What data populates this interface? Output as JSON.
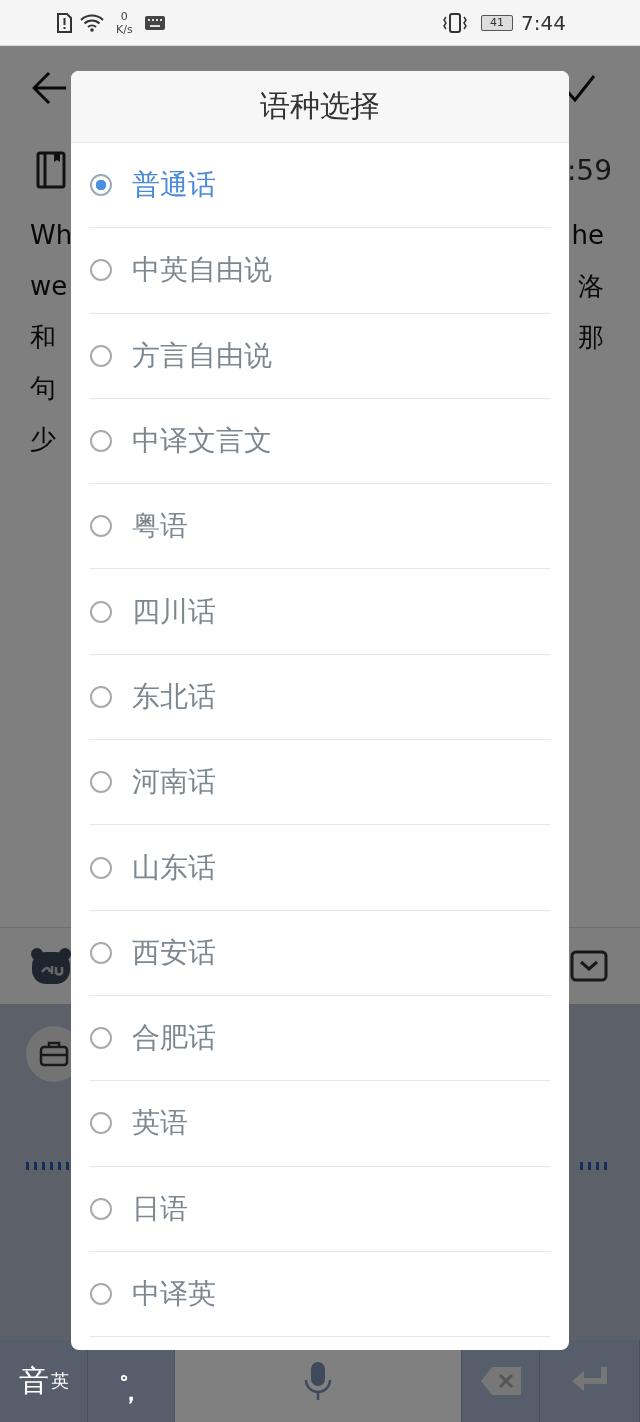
{
  "status_bar": {
    "net_speed_value": "0",
    "net_speed_unit": "K/s",
    "battery": "41",
    "time": "7:44"
  },
  "background_app": {
    "timestamp": ":59",
    "text_left": [
      "Wh",
      "we",
      "和",
      "句",
      "少"
    ],
    "text_right": [
      "he",
      "洛",
      "那"
    ]
  },
  "keyboard": {
    "keys": [
      {
        "kind": "lang",
        "label": "音",
        "sub": "英"
      },
      {
        "kind": "punct",
        "label": "。",
        "sub": "，"
      },
      {
        "kind": "mic"
      },
      {
        "kind": "delete"
      },
      {
        "kind": "enter"
      }
    ]
  },
  "dialog": {
    "title": "语种选择",
    "options": [
      {
        "label": "普通话",
        "selected": true
      },
      {
        "label": "中英自由说",
        "selected": false
      },
      {
        "label": "方言自由说",
        "selected": false
      },
      {
        "label": "中译文言文",
        "selected": false
      },
      {
        "label": "粤语",
        "selected": false
      },
      {
        "label": "四川话",
        "selected": false
      },
      {
        "label": "东北话",
        "selected": false
      },
      {
        "label": "河南话",
        "selected": false
      },
      {
        "label": "山东话",
        "selected": false
      },
      {
        "label": "西安话",
        "selected": false
      },
      {
        "label": "合肥话",
        "selected": false
      },
      {
        "label": "英语",
        "selected": false
      },
      {
        "label": "日语",
        "selected": false
      },
      {
        "label": "中译英",
        "selected": false
      }
    ]
  }
}
